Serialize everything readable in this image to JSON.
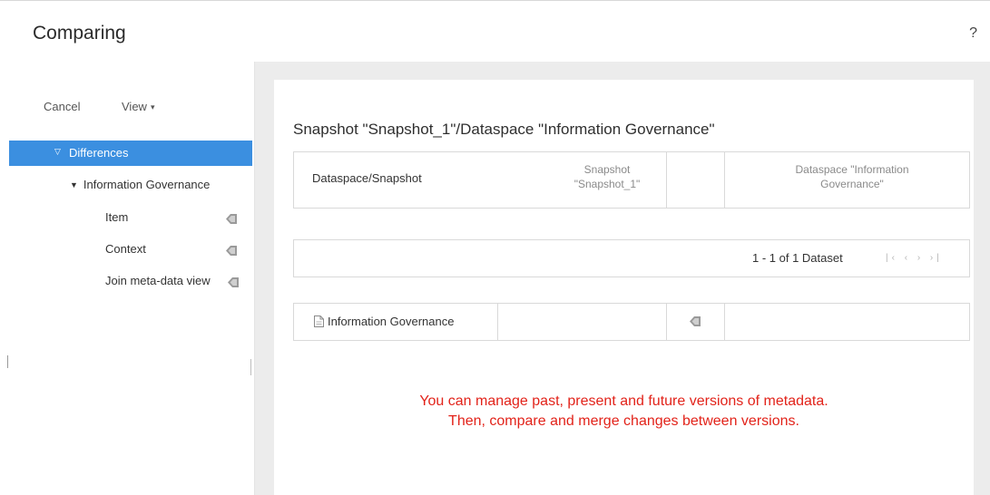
{
  "header": {
    "title": "Comparing",
    "help_label": "?"
  },
  "toolbar": {
    "cancel_label": "Cancel",
    "view_label": "View",
    "view_caret": "▾"
  },
  "tree": {
    "selected": {
      "caret": "▽",
      "label": "Differences"
    },
    "group": {
      "caret": "▼",
      "label": "Information Governance"
    },
    "children": [
      {
        "label": "Item",
        "icon": "diff-flag-icon"
      },
      {
        "label": "Context",
        "icon": "diff-flag-icon"
      },
      {
        "label": "Join meta-data view",
        "icon": "diff-flag-icon"
      }
    ]
  },
  "comparison": {
    "title": "Snapshot \"Snapshot_1\"/Dataspace \"Information Governance\"",
    "header_row": {
      "label": "Dataspace/Snapshot",
      "left_version_line1": "Snapshot",
      "left_version_line2": "\"Snapshot_1\"",
      "right_version_line1": "Dataspace \"Information",
      "right_version_line2": "Governance\""
    },
    "pager": {
      "summary": "1 - 1 of 1 Dataset",
      "nav": "|‹ ‹ › ›|"
    },
    "rows": [
      {
        "name": "Information Governance",
        "status_icon": "diff-flag-icon",
        "row_icon": "document-icon"
      }
    ]
  },
  "note": {
    "line1": "You can manage past, present and future versions of metadata.",
    "line2": "Then, compare and merge changes between versions.",
    "color": "#e2231a"
  },
  "colors": {
    "accent": "#3b8fe0",
    "panel_bg": "#ececec"
  }
}
